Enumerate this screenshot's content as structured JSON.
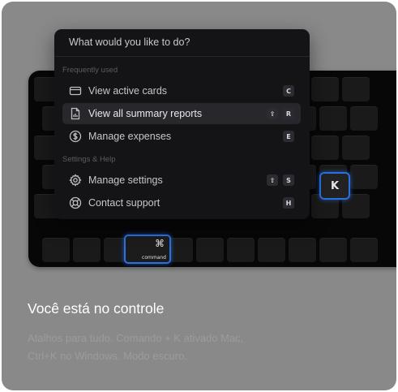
{
  "palette": {
    "search_placeholder": "What would you like to do?",
    "sections": [
      {
        "label": "Frequently used",
        "items": [
          {
            "icon": "card-icon",
            "label": "View active cards",
            "keys": [
              "C"
            ]
          },
          {
            "icon": "report-icon",
            "label": "View all summary reports",
            "keys": [
              "⇧",
              "R"
            ],
            "active": true
          },
          {
            "icon": "dollar-icon",
            "label": "Manage expenses",
            "keys": [
              "E"
            ]
          }
        ]
      },
      {
        "label": "Settings & Help",
        "items": [
          {
            "icon": "gear-icon",
            "label": "Manage settings",
            "keys": [
              "⇧",
              "S"
            ]
          },
          {
            "icon": "lifebuoy-icon",
            "label": "Contact support",
            "keys": [
              "H"
            ]
          }
        ]
      }
    ]
  },
  "keyboard": {
    "k_key": "K",
    "command_glyph": "⌘",
    "command_word": "command"
  },
  "caption": {
    "title": "Você está no controle",
    "body": "Atalhos para tudo. Comando + K ativado Mac, Ctrl+K no Windows. Modo escuro."
  },
  "colors": {
    "background": "#898989",
    "palette_bg": "#141416",
    "highlight": "#2b6fe0"
  }
}
